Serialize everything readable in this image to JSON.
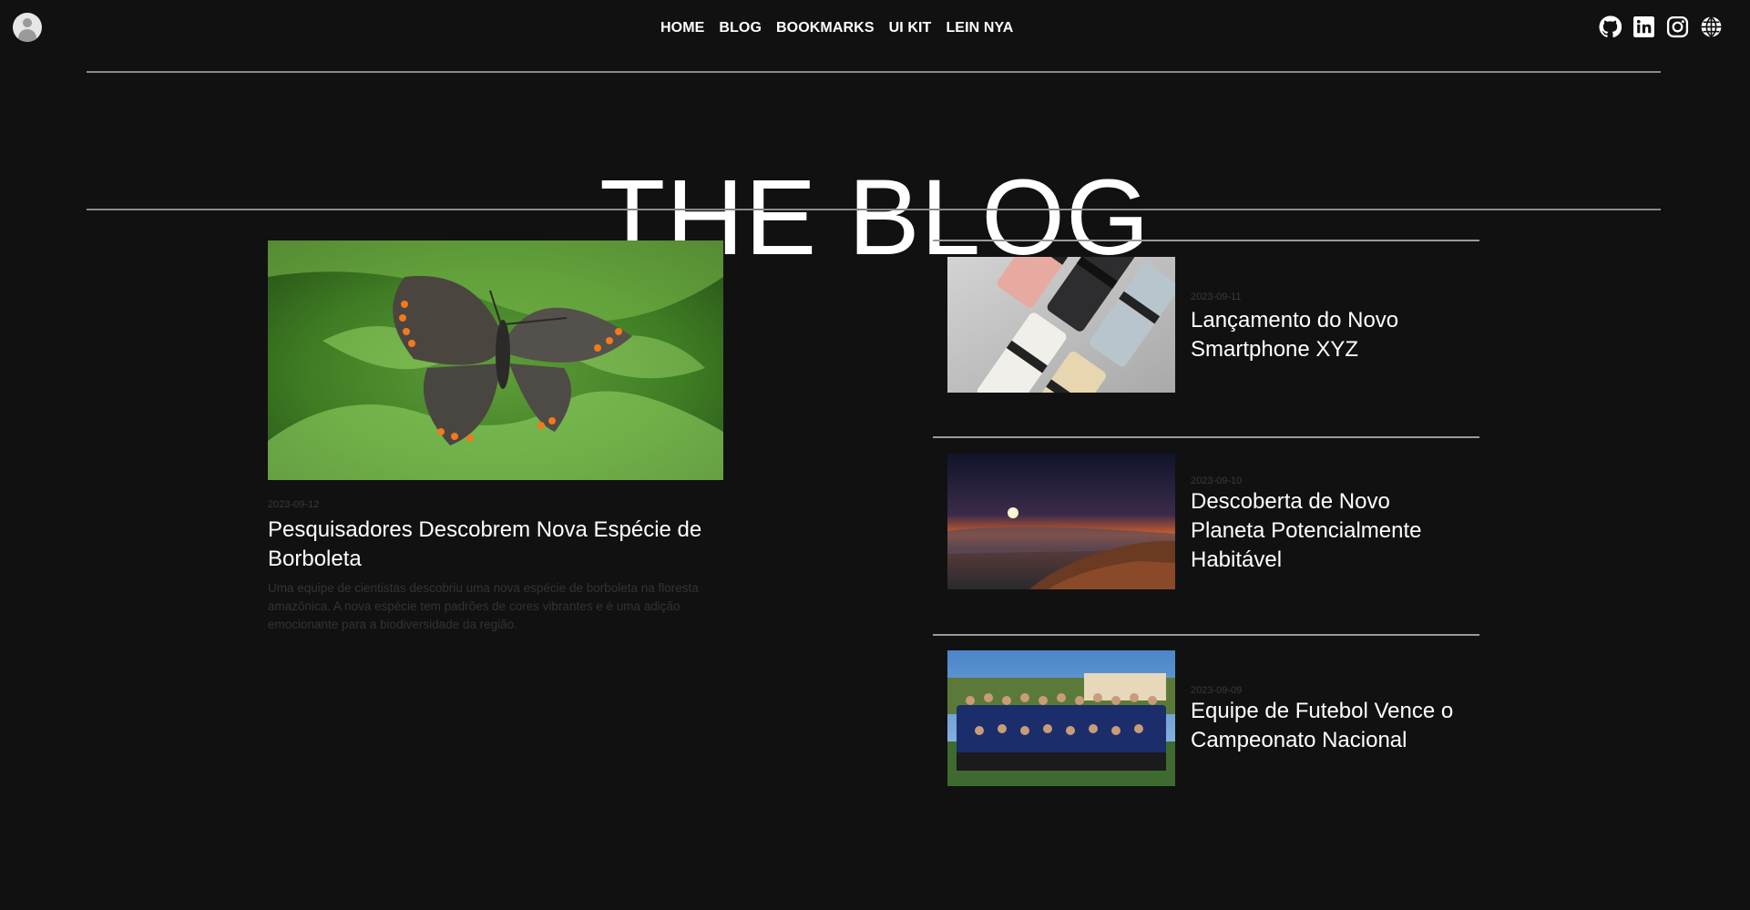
{
  "nav": {
    "items": [
      "HOME",
      "BLOG",
      "BOOKMARKS",
      "UI KIT",
      "LEIN NYA"
    ]
  },
  "social": {
    "icons": [
      "github-icon",
      "linkedin-icon",
      "instagram-icon",
      "globe-icon"
    ]
  },
  "page": {
    "title": "THE BLOG"
  },
  "featured": {
    "date": "2023-09-12",
    "title": "Pesquisadores Descobrem Nova Espécie de Borboleta",
    "excerpt": "Uma equipe de cientistas descobriu uma nova espécie de borboleta na floresta amazônica. A nova espécie tem padrões de cores vibrantes e é uma adição emocionante para a biodiversidade da região."
  },
  "posts": [
    {
      "date": "2023-09-11",
      "title": "Lançamento do Novo Smartphone XYZ"
    },
    {
      "date": "2023-09-10",
      "title": "Descoberta de Novo Planeta Potencialmente Habitável"
    },
    {
      "date": "2023-09-09",
      "title": "Equipe de Futebol Vence o Campeonato Nacional"
    }
  ],
  "colors": {
    "background": "#111111",
    "text": "#ffffff",
    "muted": "#333333",
    "rule": "#8a8a8a"
  }
}
